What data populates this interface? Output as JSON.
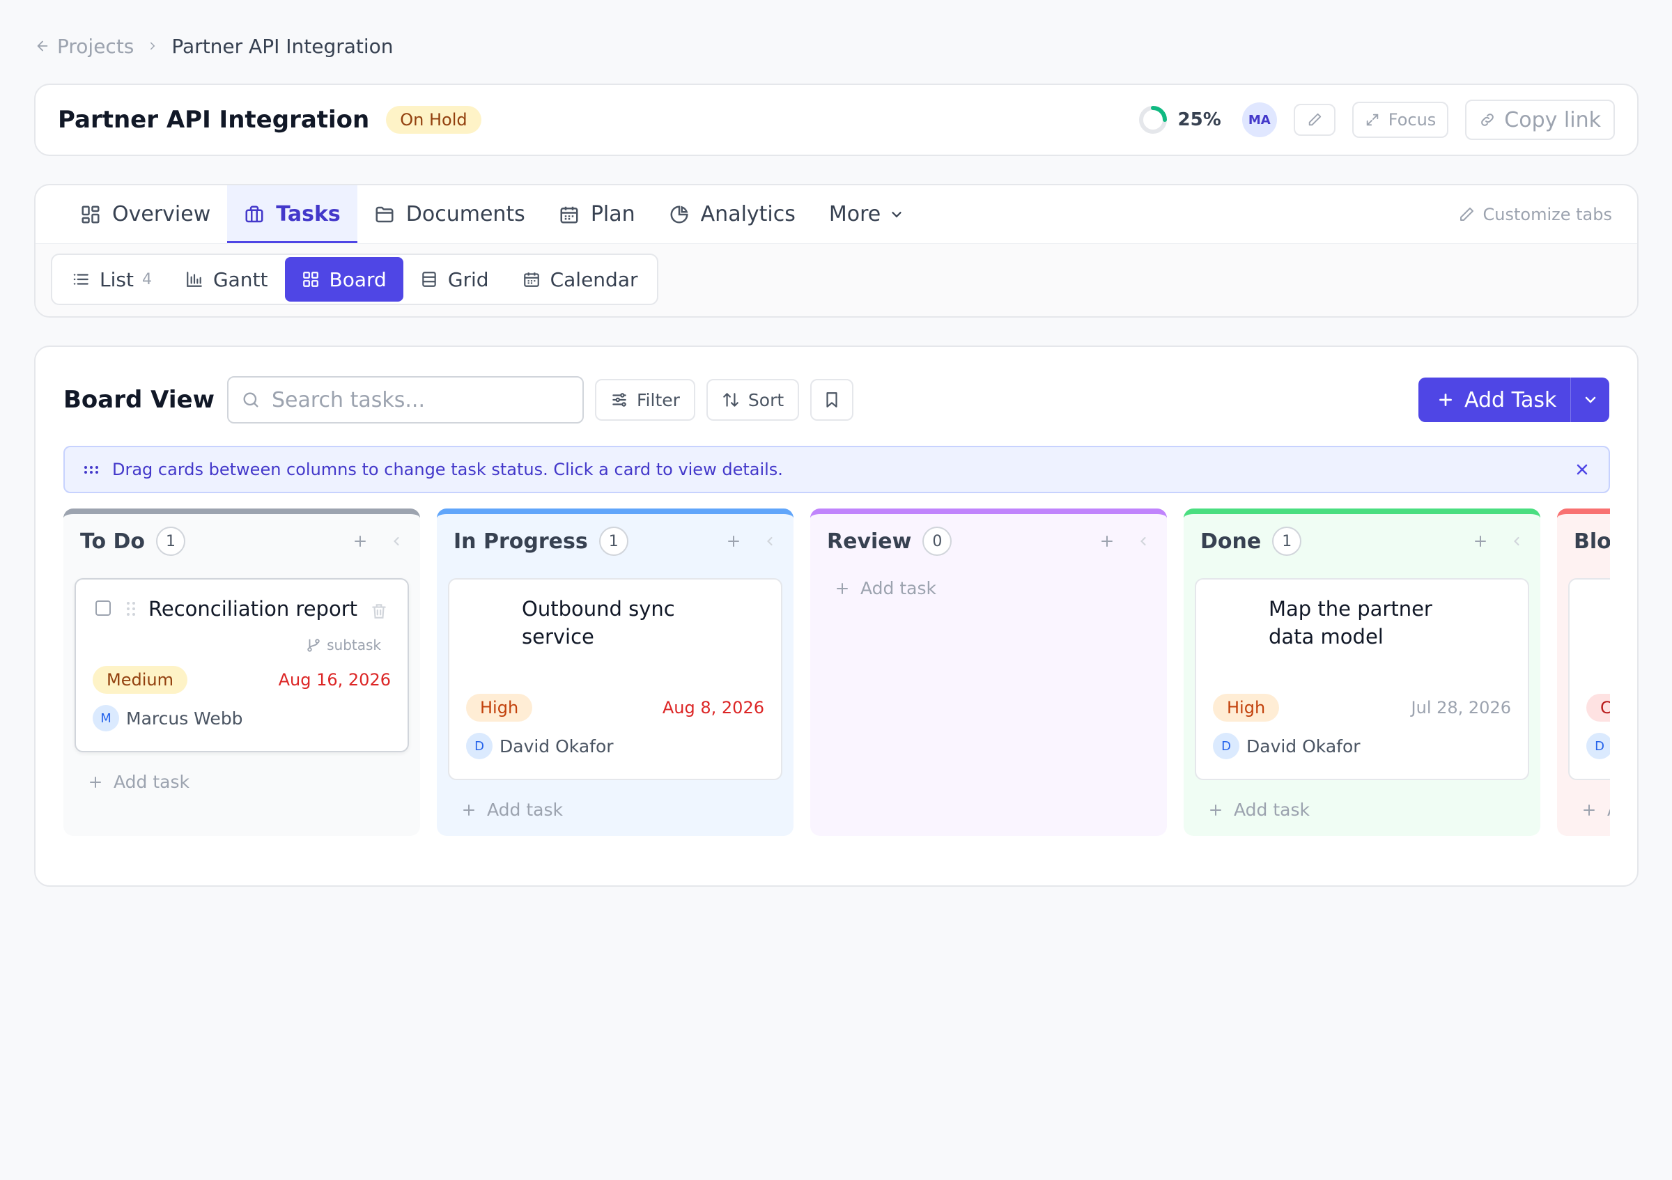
{
  "breadcrumb": {
    "parent": "Projects",
    "current": "Partner API Integration"
  },
  "header": {
    "title": "Partner API Integration",
    "status": "On Hold",
    "progress_text": "25%",
    "progress_value": 0.25,
    "avatar_initials": "MA",
    "focus_label": "Focus",
    "copy_link_label": "Copy link"
  },
  "tabs": {
    "items": [
      {
        "label": "Overview",
        "icon": "grid-icon"
      },
      {
        "label": "Tasks",
        "icon": "briefcase-icon"
      },
      {
        "label": "Documents",
        "icon": "folder-icon"
      },
      {
        "label": "Plan",
        "icon": "calendar-icon"
      },
      {
        "label": "Analytics",
        "icon": "pie-chart-icon"
      },
      {
        "label": "More",
        "icon": "chevron-down-icon"
      }
    ],
    "active": "Tasks",
    "customize_label": "Customize tabs"
  },
  "views": {
    "items": [
      {
        "label": "List",
        "count": "4"
      },
      {
        "label": "Gantt"
      },
      {
        "label": "Board"
      },
      {
        "label": "Grid"
      },
      {
        "label": "Calendar"
      }
    ],
    "active": "Board"
  },
  "board": {
    "title": "Board View",
    "search_placeholder": "Search tasks...",
    "filter_label": "Filter",
    "sort_label": "Sort",
    "add_task_label": "Add Task",
    "hint": "Drag cards between columns to change task status. Click a card to view details.",
    "add_task_row": "Add task",
    "columns": [
      {
        "name": "To Do",
        "count": "1",
        "color": "#9ca3af",
        "bg": "#f9fafb",
        "cards": [
          {
            "title": "Reconciliation report",
            "subtask": "subtask",
            "priority": "Medium",
            "due": "Aug 16, 2026",
            "assignee": "Marcus Webb",
            "initial": "M"
          }
        ]
      },
      {
        "name": "In Progress",
        "count": "1",
        "color": "#60a5fa",
        "bg": "#eff6ff",
        "cards": [
          {
            "title": "Outbound sync service",
            "priority": "High",
            "due": "Aug 8, 2026",
            "assignee": "David Okafor",
            "initial": "D"
          }
        ]
      },
      {
        "name": "Review",
        "count": "0",
        "color": "#c084fc",
        "bg": "#faf5ff",
        "cards": []
      },
      {
        "name": "Done",
        "count": "1",
        "color": "#4ade80",
        "bg": "#f0fdf4",
        "cards": [
          {
            "title": "Map the partner data model",
            "priority": "High",
            "due": "Jul 28, 2026",
            "assignee": "David Okafor",
            "initial": "D"
          }
        ]
      },
      {
        "name": "Blo",
        "color": "#f87171",
        "bg": "#fef2f2",
        "cards": [
          {
            "priority": "C",
            "initial": "D"
          }
        ]
      }
    ]
  },
  "colors": {
    "accent": "#4f46e5",
    "overdue": "#dc2626"
  }
}
